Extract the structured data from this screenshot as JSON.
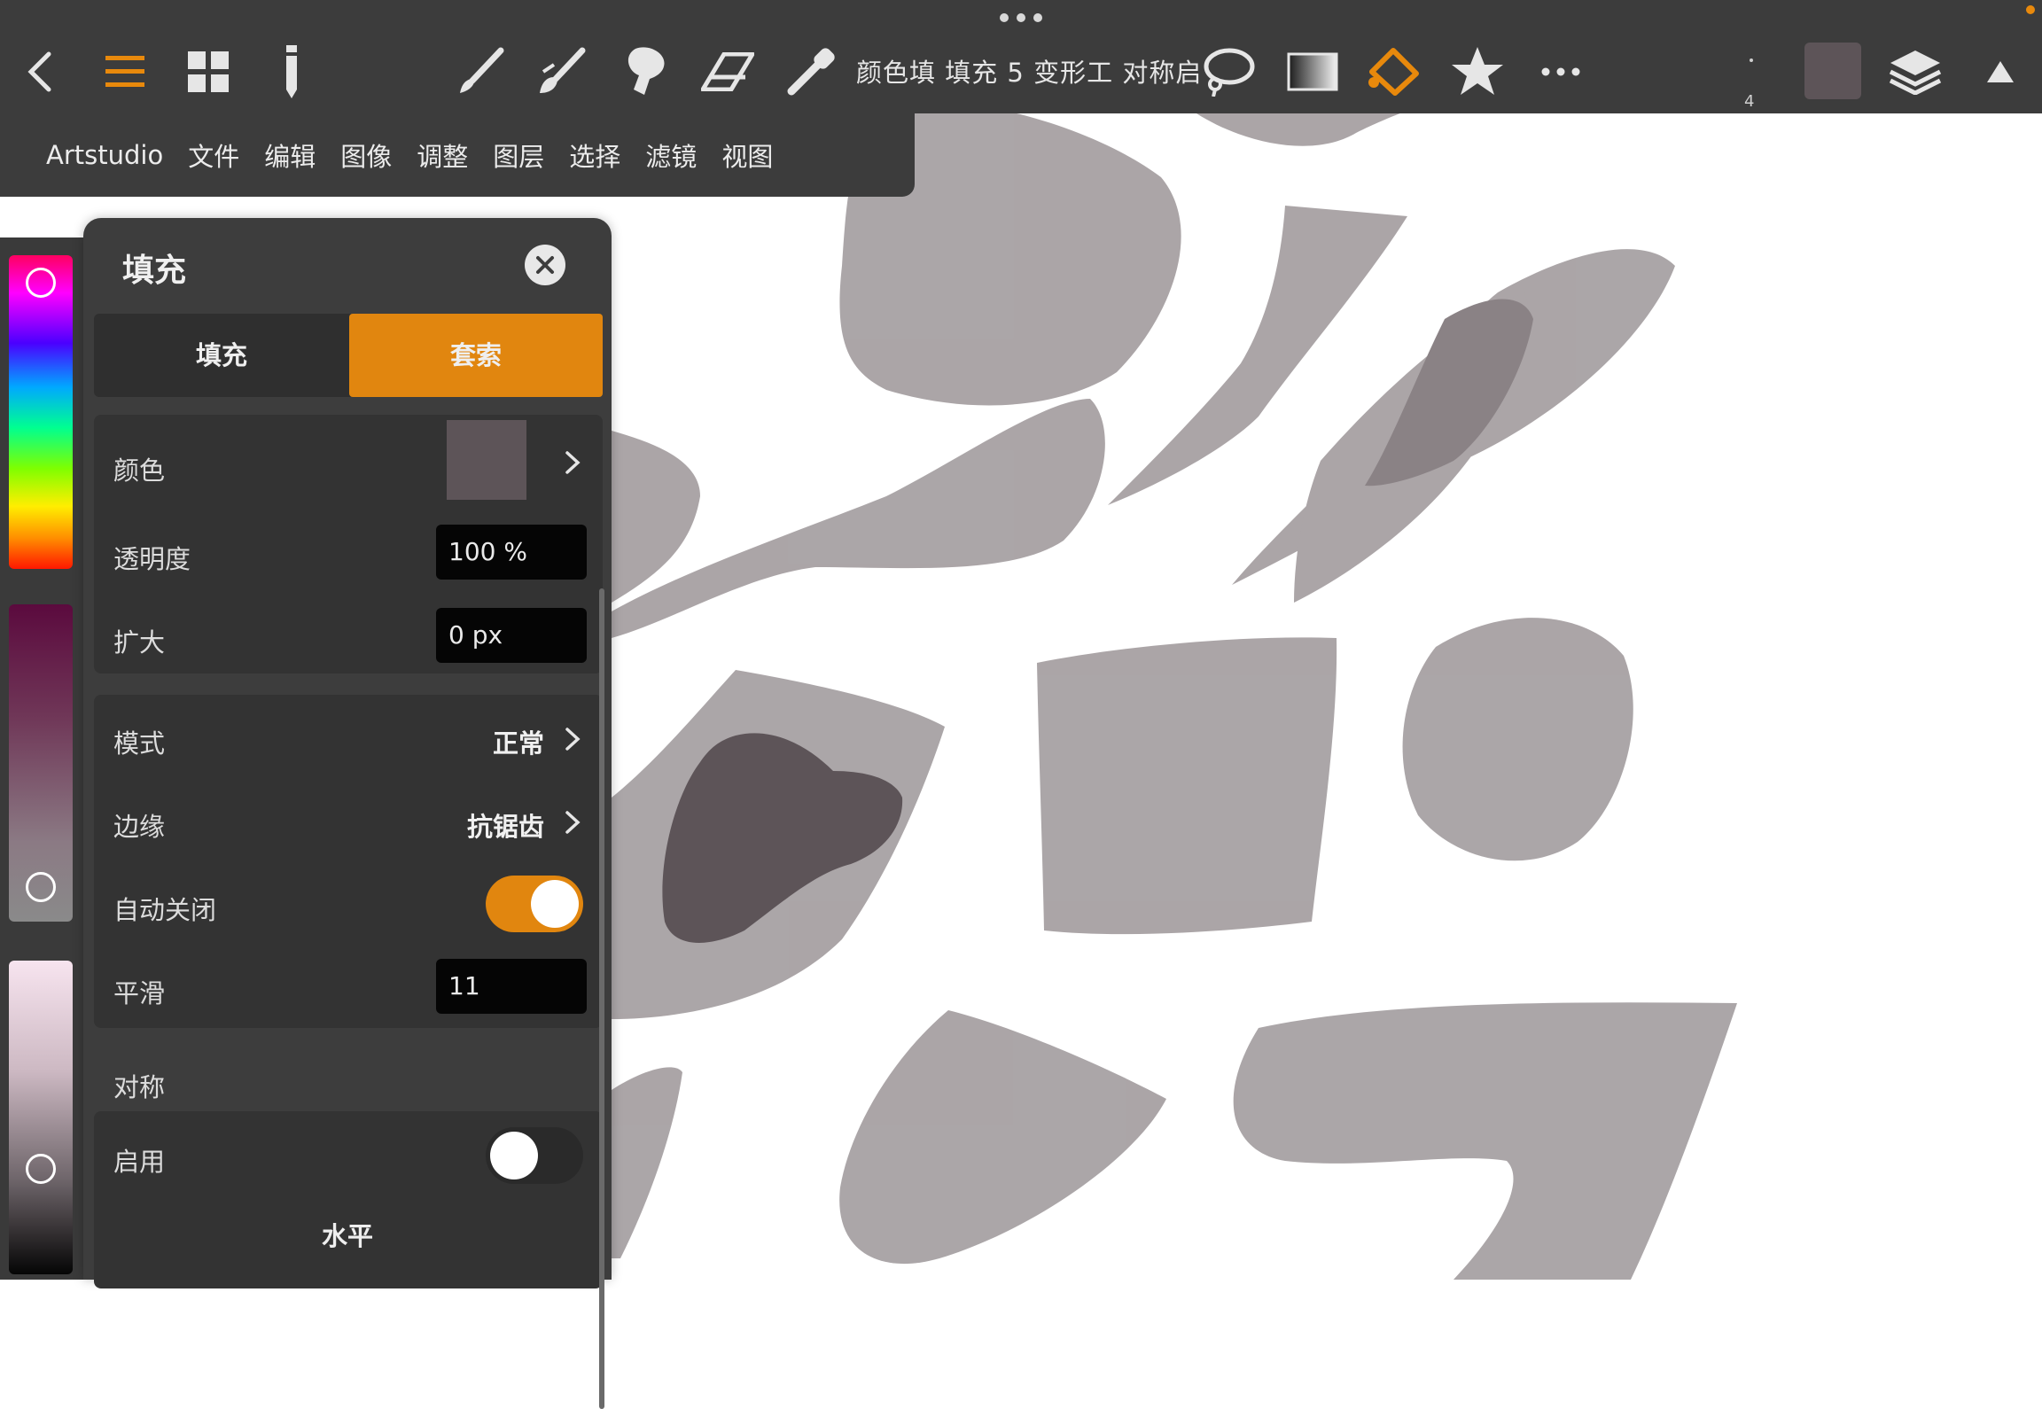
{
  "toolbar": {
    "icons": [
      "back-icon",
      "menu-icon",
      "grid-icon",
      "pen-icon",
      "brush-icon",
      "smudge-brush-icon",
      "stamp-icon",
      "eraser-icon",
      "eyedropper-icon",
      "lasso-icon",
      "gradient-icon",
      "fill-bucket-icon",
      "star-icon",
      "more-icon",
      "layers-icon",
      "collapse-icon"
    ],
    "quick_labels": "颜色填 填充 5 变形工 对称启",
    "layer_count": "4",
    "current_color": "#5d5458",
    "accent": "#e8890c"
  },
  "menubar": {
    "items": [
      "Artstudio",
      "文件",
      "编辑",
      "图像",
      "调整",
      "图层",
      "选择",
      "滤镜",
      "视图"
    ]
  },
  "panel": {
    "title": "填充",
    "tabs": [
      {
        "label": "填充",
        "active": false
      },
      {
        "label": "套索",
        "active": true
      }
    ],
    "color_label": "颜色",
    "color_value": "#5d5458",
    "opacity_label": "透明度",
    "opacity_value": "100 %",
    "expand_label": "扩大",
    "expand_value": "0 px",
    "mode_label": "模式",
    "mode_value": "正常",
    "edge_label": "边缘",
    "edge_value": "抗锯齿",
    "autoclose_label": "自动关闭",
    "autoclose_on": true,
    "smooth_label": "平滑",
    "smooth_value": "11",
    "symmetry_section": "对称",
    "enable_label": "启用",
    "enable_on": false,
    "horizontal_label": "水平"
  }
}
